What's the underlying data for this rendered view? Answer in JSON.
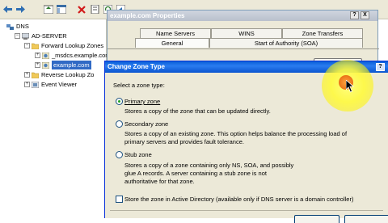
{
  "toolbar": {
    "buttons": [
      "back-icon",
      "forward-icon",
      "up-icon",
      "show-tree-icon",
      "delete-icon",
      "properties-icon",
      "refresh-icon",
      "export-icon",
      "help-icon",
      "server-icon",
      "list-icon",
      "new-icon",
      "filter-icon"
    ]
  },
  "tree": {
    "root": "DNS",
    "server": "AD-SERVER",
    "forward": "Forward Lookup Zones",
    "msdcs": "_msdcs.example.com",
    "example": "example.com",
    "reverse": "Reverse Lookup Zo",
    "events": "Event Viewer"
  },
  "properties": {
    "title": "example.com Properties",
    "tabs_row1": [
      "Name Servers",
      "WINS",
      "Zone Transfers"
    ],
    "tabs_row2": [
      "General",
      "Start of Authority (SOA)"
    ]
  },
  "change_zone": {
    "title": "Change Zone Type",
    "prompt": "Select a zone type:",
    "primary": {
      "label": "Primary zone",
      "selected": true,
      "desc": [
        "Stores a copy of the zone that can be updated directly."
      ]
    },
    "secondary": {
      "label": "Secondary zone",
      "selected": false,
      "desc": [
        "Stores a copy of an existing zone. This option helps balance the processing load of",
        "primary servers and provides fault tolerance."
      ]
    },
    "stub": {
      "label": "Stub zone",
      "selected": false,
      "desc": [
        "Stores a copy of a zone containing only NS, SOA, and possibly",
        "glue A records. A server containing a stub zone is not",
        "authoritative for that zone."
      ]
    },
    "ad_store": {
      "label": "Store the zone in Active Directory (available only if DNS server is a domain controller)",
      "checked": false
    }
  },
  "title_buttons": {
    "help": "?",
    "close": "X"
  }
}
